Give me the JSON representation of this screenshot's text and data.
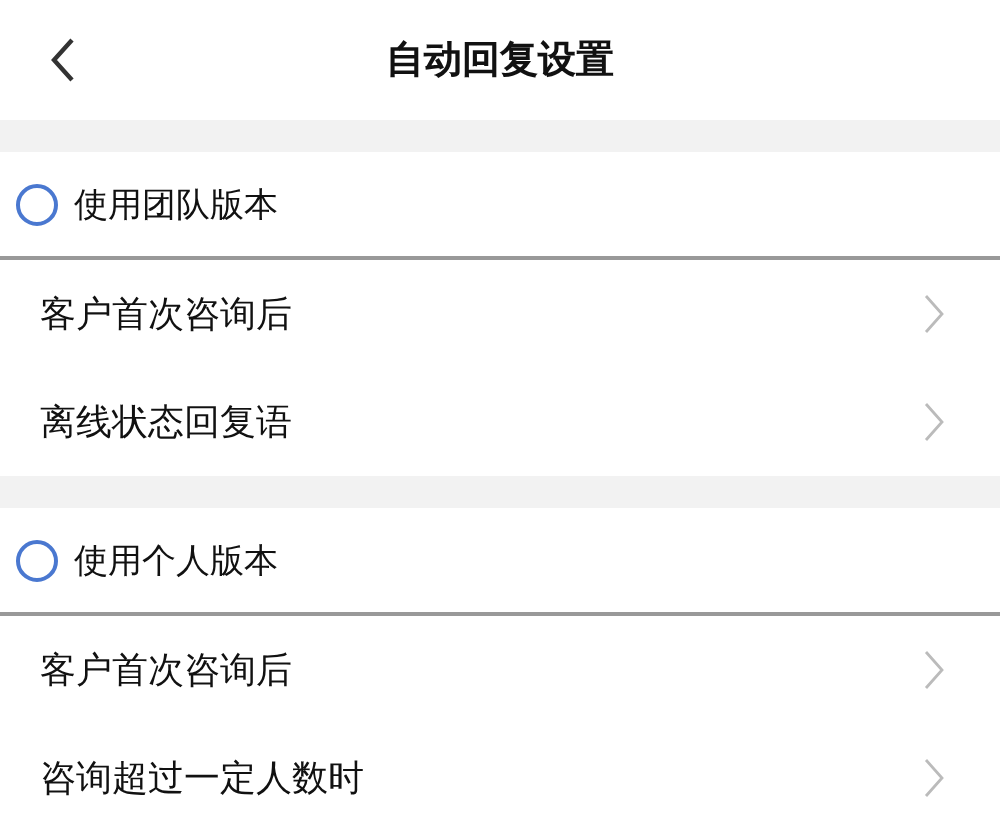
{
  "header": {
    "title": "自动回复设置"
  },
  "sections": [
    {
      "option": {
        "label": "使用团队版本",
        "selected": false
      },
      "items": [
        {
          "label": "客户首次咨询后"
        },
        {
          "label": "离线状态回复语"
        }
      ]
    },
    {
      "option": {
        "label": "使用个人版本",
        "selected": false
      },
      "items": [
        {
          "label": "客户首次咨询后"
        },
        {
          "label": "咨询超过一定人数时"
        }
      ]
    }
  ]
}
